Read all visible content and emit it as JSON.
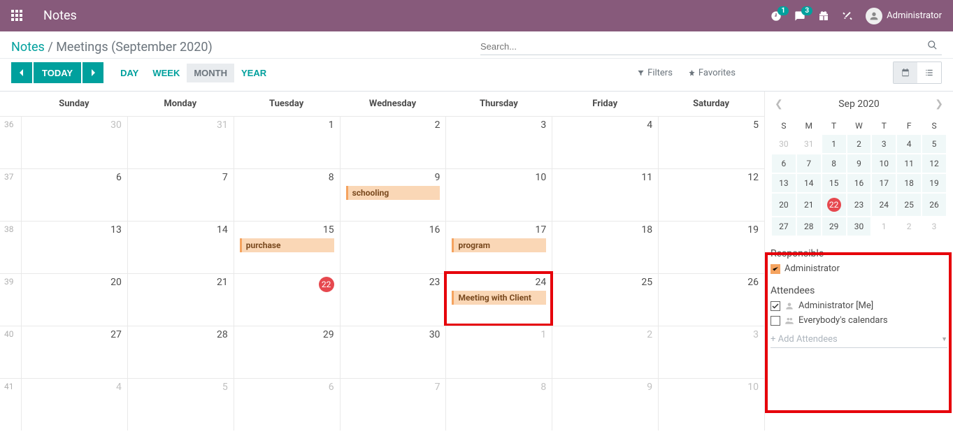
{
  "topbar": {
    "app_title": "Notes",
    "clock_badge": "1",
    "chat_badge": "3",
    "username": "Administrator"
  },
  "breadcrumb": {
    "root": "Notes",
    "sep": "/",
    "current": "Meetings (September 2020)"
  },
  "search": {
    "placeholder": "Search..."
  },
  "nav": {
    "today": "TODAY",
    "scales": {
      "day": "DAY",
      "week": "WEEK",
      "month": "MONTH",
      "year": "YEAR"
    }
  },
  "filters": {
    "filters": "Filters",
    "favorites": "Favorites"
  },
  "calendar": {
    "day_headers": [
      "Sunday",
      "Monday",
      "Tuesday",
      "Wednesday",
      "Thursday",
      "Friday",
      "Saturday"
    ],
    "weeks": [
      {
        "wk": "36",
        "days": [
          {
            "n": "30",
            "muted": true
          },
          {
            "n": "31",
            "muted": true
          },
          {
            "n": "1"
          },
          {
            "n": "2"
          },
          {
            "n": "3"
          },
          {
            "n": "4"
          },
          {
            "n": "5"
          }
        ]
      },
      {
        "wk": "37",
        "days": [
          {
            "n": "6"
          },
          {
            "n": "7"
          },
          {
            "n": "8"
          },
          {
            "n": "9",
            "events": [
              "schooling"
            ]
          },
          {
            "n": "10"
          },
          {
            "n": "11"
          },
          {
            "n": "12"
          }
        ]
      },
      {
        "wk": "38",
        "days": [
          {
            "n": "13"
          },
          {
            "n": "14"
          },
          {
            "n": "15",
            "events": [
              "purchase"
            ]
          },
          {
            "n": "16"
          },
          {
            "n": "17",
            "events": [
              "program"
            ]
          },
          {
            "n": "18"
          },
          {
            "n": "19"
          }
        ]
      },
      {
        "wk": "39",
        "days": [
          {
            "n": "20"
          },
          {
            "n": "21"
          },
          {
            "n": "22",
            "today": true
          },
          {
            "n": "23"
          },
          {
            "n": "24",
            "events": [
              "Meeting with Client"
            ],
            "highlighted": true
          },
          {
            "n": "25"
          },
          {
            "n": "26"
          }
        ]
      },
      {
        "wk": "40",
        "days": [
          {
            "n": "27"
          },
          {
            "n": "28"
          },
          {
            "n": "29"
          },
          {
            "n": "30"
          },
          {
            "n": "1",
            "muted": true
          },
          {
            "n": "2",
            "muted": true
          },
          {
            "n": "3",
            "muted": true
          }
        ]
      },
      {
        "wk": "41",
        "days": [
          {
            "n": "4",
            "muted": true
          },
          {
            "n": "5",
            "muted": true
          },
          {
            "n": "6",
            "muted": true
          },
          {
            "n": "7",
            "muted": true
          },
          {
            "n": "8",
            "muted": true
          },
          {
            "n": "9",
            "muted": true
          },
          {
            "n": "10",
            "muted": true
          }
        ]
      }
    ]
  },
  "mini_cal": {
    "title": "Sep 2020",
    "dow": [
      "S",
      "M",
      "T",
      "W",
      "T",
      "F",
      "S"
    ],
    "rows": [
      [
        {
          "n": "30",
          "m": true
        },
        {
          "n": "31",
          "m": true
        },
        {
          "n": "1"
        },
        {
          "n": "2"
        },
        {
          "n": "3"
        },
        {
          "n": "4"
        },
        {
          "n": "5"
        }
      ],
      [
        {
          "n": "6"
        },
        {
          "n": "7"
        },
        {
          "n": "8"
        },
        {
          "n": "9"
        },
        {
          "n": "10"
        },
        {
          "n": "11"
        },
        {
          "n": "12"
        }
      ],
      [
        {
          "n": "13"
        },
        {
          "n": "14"
        },
        {
          "n": "15"
        },
        {
          "n": "16"
        },
        {
          "n": "17"
        },
        {
          "n": "18"
        },
        {
          "n": "19"
        }
      ],
      [
        {
          "n": "20"
        },
        {
          "n": "21"
        },
        {
          "n": "22",
          "t": true
        },
        {
          "n": "23"
        },
        {
          "n": "24"
        },
        {
          "n": "25"
        },
        {
          "n": "26"
        }
      ],
      [
        {
          "n": "27"
        },
        {
          "n": "28"
        },
        {
          "n": "29"
        },
        {
          "n": "30"
        },
        {
          "n": "1",
          "m": true
        },
        {
          "n": "2",
          "m": true
        },
        {
          "n": "3",
          "m": true
        }
      ]
    ]
  },
  "side": {
    "responsible_title": "Responsible",
    "responsible_name": "Administrator",
    "attendees_title": "Attendees",
    "attendee_me": "Administrator [Me]",
    "everybody": "Everybody's calendars",
    "add_placeholder": "+ Add Attendees"
  }
}
